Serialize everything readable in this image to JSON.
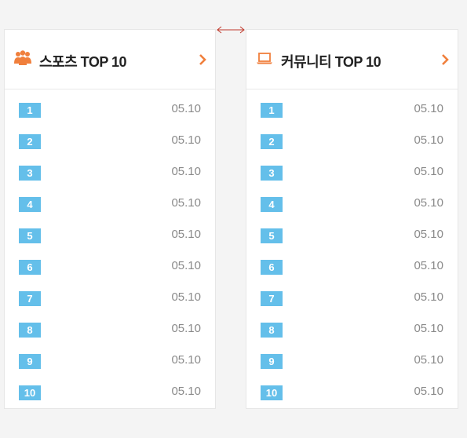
{
  "colors": {
    "accent": "#f07f3c",
    "rank_badge": "#64bfea",
    "date_text": "#8a8a8a",
    "title_text": "#222222",
    "resize_arrow": "#c0392b"
  },
  "panels": [
    {
      "id": "sports",
      "icon": "users-icon",
      "title": "스포츠 TOP 10",
      "more_icon": "chevron-right-icon",
      "items": [
        {
          "rank": "1",
          "date": "05.10"
        },
        {
          "rank": "2",
          "date": "05.10"
        },
        {
          "rank": "3",
          "date": "05.10"
        },
        {
          "rank": "4",
          "date": "05.10"
        },
        {
          "rank": "5",
          "date": "05.10"
        },
        {
          "rank": "6",
          "date": "05.10"
        },
        {
          "rank": "7",
          "date": "05.10"
        },
        {
          "rank": "8",
          "date": "05.10"
        },
        {
          "rank": "9",
          "date": "05.10"
        },
        {
          "rank": "10",
          "date": "05.10"
        }
      ]
    },
    {
      "id": "community",
      "icon": "laptop-icon",
      "title": "커뮤니티 TOP 10",
      "more_icon": "chevron-right-icon",
      "items": [
        {
          "rank": "1",
          "date": "05.10"
        },
        {
          "rank": "2",
          "date": "05.10"
        },
        {
          "rank": "3",
          "date": "05.10"
        },
        {
          "rank": "4",
          "date": "05.10"
        },
        {
          "rank": "5",
          "date": "05.10"
        },
        {
          "rank": "6",
          "date": "05.10"
        },
        {
          "rank": "7",
          "date": "05.10"
        },
        {
          "rank": "8",
          "date": "05.10"
        },
        {
          "rank": "9",
          "date": "05.10"
        },
        {
          "rank": "10",
          "date": "05.10"
        }
      ]
    }
  ]
}
